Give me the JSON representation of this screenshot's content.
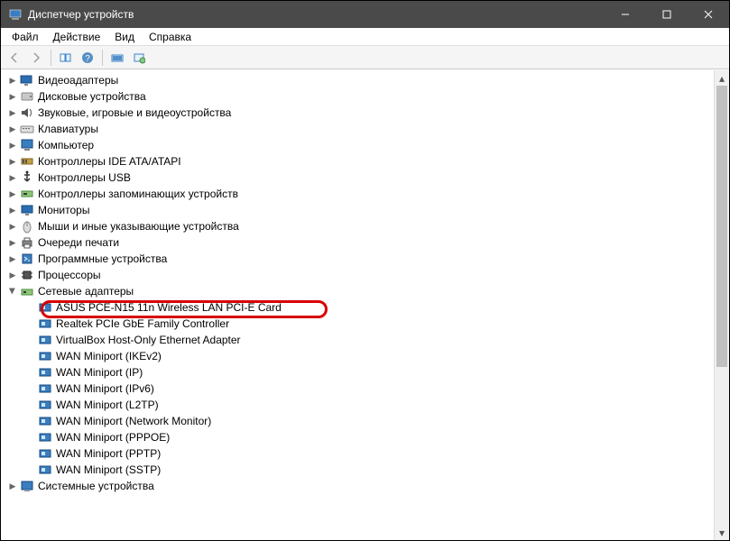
{
  "window": {
    "title": "Диспетчер устройств"
  },
  "menu": {
    "file": "Файл",
    "action": "Действие",
    "view": "Вид",
    "help": "Справка"
  },
  "tree": {
    "video": "Видеоадаптеры",
    "disk": "Дисковые устройства",
    "audio": "Звуковые, игровые и видеоустройства",
    "keyboard": "Клавиатуры",
    "computer": "Компьютер",
    "ide": "Контроллеры IDE ATA/ATAPI",
    "usb": "Контроллеры USB",
    "storage_ctrl": "Контроллеры запоминающих устройств",
    "monitor": "Мониторы",
    "hid": "Мыши и иные указывающие устройства",
    "print": "Очереди печати",
    "software": "Программные устройства",
    "cpu": "Процессоры",
    "net": "Сетевые адаптеры",
    "net_items": {
      "asus": "ASUS PCE-N15 11n Wireless LAN PCI-E Card",
      "realtek": "Realtek PCIe GbE Family Controller",
      "vbox": "VirtualBox Host-Only Ethernet Adapter",
      "wan_ikev2": "WAN Miniport (IKEv2)",
      "wan_ip": "WAN Miniport (IP)",
      "wan_ipv6": "WAN Miniport (IPv6)",
      "wan_l2tp": "WAN Miniport (L2TP)",
      "wan_netmon": "WAN Miniport (Network Monitor)",
      "wan_pppoe": "WAN Miniport (PPPOE)",
      "wan_pptp": "WAN Miniport (PPTP)",
      "wan_sstp": "WAN Miniport (SSTP)"
    },
    "system": "Системные устройства"
  }
}
